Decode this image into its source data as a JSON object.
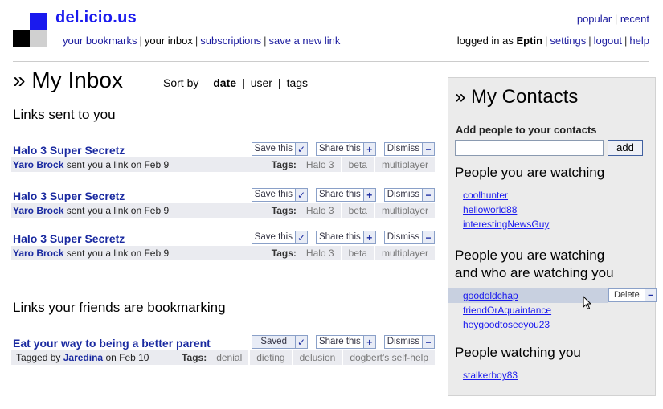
{
  "brand": {
    "name": "del.icio.us",
    "logo_colors": [
      "#1a1aee",
      "#000000",
      "#d0d0d0",
      "#ffffff"
    ]
  },
  "nav": {
    "items": [
      {
        "label": "your bookmarks",
        "current": false
      },
      {
        "label": "your inbox",
        "current": true
      },
      {
        "label": "subscriptions",
        "current": false
      },
      {
        "label": "save a new link",
        "current": false
      }
    ]
  },
  "top_links": {
    "popular": "popular",
    "recent": "recent",
    "sep": "|"
  },
  "account": {
    "logged_in_prefix": "logged in as",
    "username": "Eptin",
    "settings": "settings",
    "logout": "logout",
    "help": "help"
  },
  "page": {
    "title": "» My Inbox",
    "sort_label": "Sort by",
    "sort_options": [
      {
        "label": "date",
        "active": true
      },
      {
        "label": "user",
        "active": false
      },
      {
        "label": "tags",
        "active": false
      }
    ]
  },
  "sections": {
    "sent_title": "Links sent to you",
    "friends_title": "Links your friends are bookmarking"
  },
  "sent_links": [
    {
      "title": "Halo 3 Super Secretz",
      "user": "Yaro Brock",
      "action_text": "sent you a link on Feb 9",
      "tags_label": "Tags:",
      "tags": [
        "Halo 3",
        "beta",
        "multiplayer"
      ],
      "save_label": "Save this",
      "share_label": "Share this",
      "dismiss_label": "Dismiss"
    },
    {
      "title": "Halo 3 Super Secretz",
      "user": "Yaro Brock",
      "action_text": "sent you a link on Feb 9",
      "tags_label": "Tags:",
      "tags": [
        "Halo 3",
        "beta",
        "multiplayer"
      ],
      "save_label": "Save this",
      "share_label": "Share this",
      "dismiss_label": "Dismiss"
    },
    {
      "title": "Halo 3 Super Secretz",
      "user": "Yaro Brock",
      "action_text": "sent you a link on Feb 9",
      "tags_label": "Tags:",
      "tags": [
        "Halo 3",
        "beta",
        "multiplayer"
      ],
      "save_label": "Save this",
      "share_label": "Share this",
      "dismiss_label": "Dismiss"
    }
  ],
  "friend_links": [
    {
      "title": "Eat your way to being a better parent",
      "tagged_prefix": "Tagged by",
      "user": "Jaredina",
      "date_text": "on Feb 10",
      "tags_label": "Tags:",
      "tags": [
        "denial",
        "dieting",
        "delusion",
        "dogbert's self-help"
      ],
      "saved_label": "Saved",
      "share_label": "Share this",
      "dismiss_label": "Dismiss"
    }
  ],
  "sidebar": {
    "title": "» My Contacts",
    "add_label": "Add people to your contacts",
    "add_input_value": "",
    "add_button": "add",
    "watching_heading": "People you are watching",
    "watching": [
      "coolhunter",
      "helloworld88",
      "interestingNewsGuy"
    ],
    "mutual_heading_line1": "People you are watching",
    "mutual_heading_line2": "and who are watching you",
    "mutual": [
      "goodoldchap",
      "friendOrAquaintance",
      "heygoodtoseeyou23"
    ],
    "delete_label": "Delete",
    "watchers_heading": "People watching you",
    "watchers": [
      "stalkerboy83"
    ]
  },
  "icons": {
    "check": "check-icon",
    "plus": "plus-icon",
    "minus": "minus-icon"
  }
}
